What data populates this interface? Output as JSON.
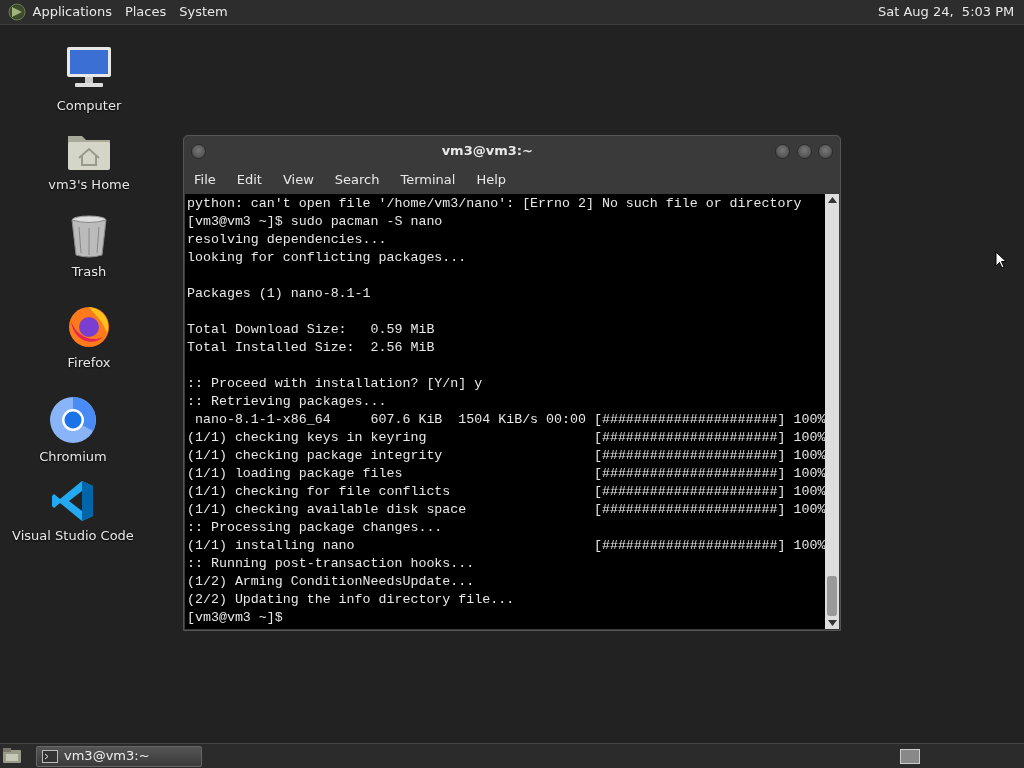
{
  "top_panel": {
    "menus": [
      "Applications",
      "Places",
      "System"
    ],
    "clock": "Sat Aug 24,  5:03 PM"
  },
  "desktop_icons": [
    {
      "label": "Computer",
      "kind": "computer"
    },
    {
      "label": "vm3's Home",
      "kind": "home"
    },
    {
      "label": "Trash",
      "kind": "trash"
    },
    {
      "label": "Firefox",
      "kind": "firefox"
    },
    {
      "label": "Chromium",
      "kind": "chromium"
    },
    {
      "label": "Visual Studio Code",
      "kind": "code"
    }
  ],
  "terminal": {
    "title": "vm3@vm3:~",
    "menu": [
      "File",
      "Edit",
      "View",
      "Search",
      "Terminal",
      "Help"
    ],
    "paragraphs": [
      [
        "python: can't open file '/home/vm3/nano': [Errno 2] No such file or directory",
        "[vm3@vm3 ~]$ sudo pacman -S nano",
        "resolving dependencies...",
        "looking for conflicting packages..."
      ],
      [
        "Packages (1) nano-8.1-1"
      ],
      [
        "Total Download Size:   0.59 MiB",
        "Total Installed Size:  2.56 MiB"
      ],
      [
        ":: Proceed with installation? [Y/n] y",
        ":: Retrieving packages...",
        " nano-8.1-1-x86_64     607.6 KiB  1504 KiB/s 00:00 [######################] 100%",
        "(1/1) checking keys in keyring                     [######################] 100%",
        "(1/1) checking package integrity                   [######################] 100%",
        "(1/1) loading package files                        [######################] 100%",
        "(1/1) checking for file conflicts                  [######################] 100%",
        "(1/1) checking available disk space                [######################] 100%",
        ":: Processing package changes...",
        "(1/1) installing nano                              [######################] 100%",
        ":: Running post-transaction hooks...",
        "(1/2) Arming ConditionNeedsUpdate...",
        "(2/2) Updating the info directory file...",
        "[vm3@vm3 ~]$"
      ]
    ]
  },
  "taskbar": {
    "windows": [
      {
        "label": "vm3@vm3:~",
        "selected": true
      }
    ]
  }
}
